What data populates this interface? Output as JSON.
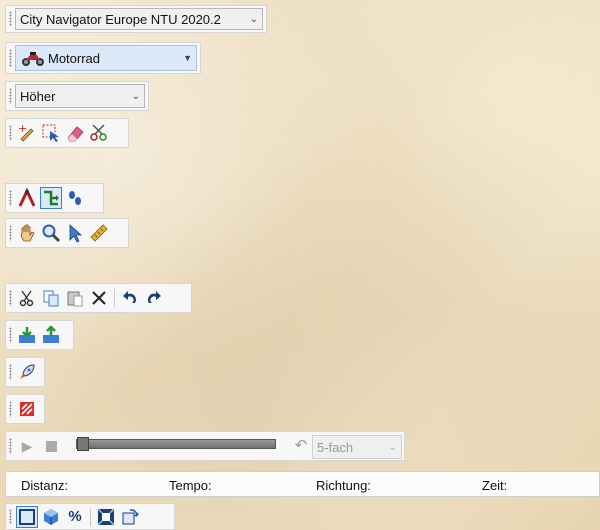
{
  "map_select": {
    "value": "City Navigator Europe NTU 2020.2"
  },
  "profile_select": {
    "value": "Motorrad",
    "icon": "motorcycle-icon"
  },
  "altitude_select": {
    "value": "Höher"
  },
  "edit_tools": [
    "add-waypoint-icon",
    "select-area-icon",
    "eraser-icon",
    "scissors-route-icon"
  ],
  "route_tools": [
    "route-draw-icon",
    "route-split-icon",
    "footprints-icon"
  ],
  "nav_tools": [
    "hand-pan-icon",
    "zoom-icon",
    "pointer-arrow-icon",
    "ruler-icon"
  ],
  "clipboard_tools": [
    "cut-icon",
    "copy-icon",
    "paste-icon",
    "delete-icon",
    "undo-icon",
    "redo-icon"
  ],
  "playback": {
    "speed": "5-fach",
    "position": 0.0
  },
  "status_bar": {
    "distance_label": "Distanz:",
    "speed_label": "Tempo:",
    "direction_label": "Richtung:",
    "time_label": "Zeit:"
  },
  "colors": {
    "paper": "#ecdfc4",
    "toolbar": "#f7f7f7",
    "accent": "#3c7fd0"
  }
}
